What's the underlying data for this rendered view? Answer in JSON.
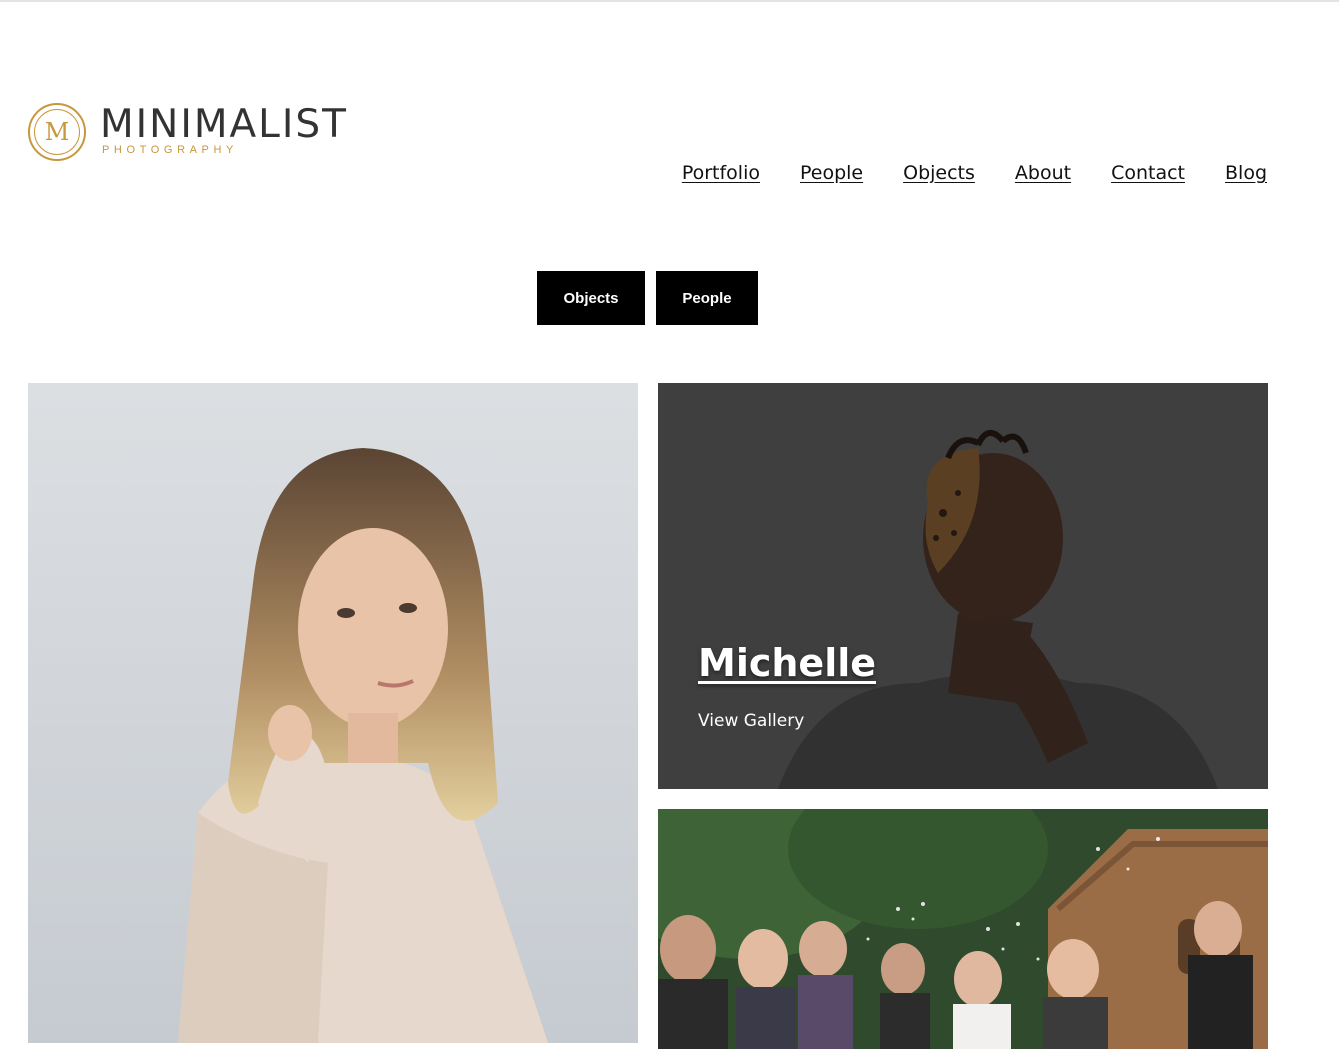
{
  "brand": {
    "logo_letter": "M",
    "name": "MINIMALIST",
    "tagline": "PHOTOGRAPHY",
    "accent_color": "#c8973c"
  },
  "nav": {
    "items": [
      "Portfolio",
      "People",
      "Objects",
      "About",
      "Contact",
      "Blog"
    ]
  },
  "filters": {
    "objects_label": "Objects",
    "people_label": "People"
  },
  "gallery": {
    "featured": {
      "title": "Michelle",
      "link_label": "View Gallery"
    }
  }
}
